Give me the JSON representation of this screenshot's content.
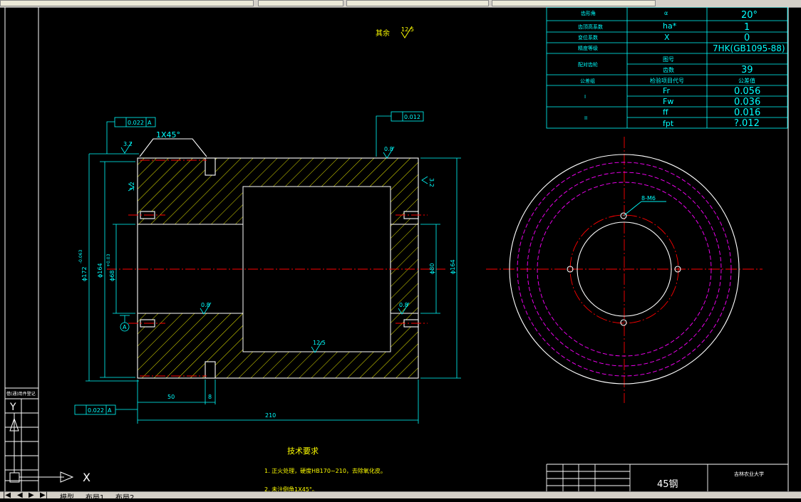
{
  "window": {
    "title": "",
    "top_tabs": [
      "",
      "",
      "",
      ""
    ]
  },
  "ucs": {
    "x_label": "X",
    "y_label": "Y"
  },
  "notes": {
    "surface_rest": "其余",
    "surface_rest_ra": "12.5",
    "tech_req_title": "技术要求",
    "tech_req_1": "1. 正火处理，硬度HB170~210，去除氧化皮。",
    "tech_req_2": "2. 未注倒角1X45°。"
  },
  "section": {
    "chamfer": "1X45°",
    "ra_top_left": "3.2",
    "ra_left_face": "3.2",
    "ra_top_right": "0.8",
    "ra_right_face": "3.2",
    "ra_bore_left": "0.8",
    "ra_bore_right": "0.8",
    "ra_recess": "12.5",
    "gtol_runout_value": "0.022",
    "gtol_runout_datum": "A",
    "gtol_flat_value": "0.012",
    "gtol_bottom_value": "0.022",
    "gtol_bottom_datum": "A",
    "datum_label": "A",
    "dim_outer": "ϕ172",
    "dim_outer_tol": "-0.063",
    "dim_left_bore": "ϕ164",
    "dim_bore_fit": "ϕ68",
    "dim_bore_tol": "+0.03",
    "dim_right_bore": "ϕ80",
    "dim_right_outer": "ϕ164",
    "dim_50": "50",
    "dim_8": "8",
    "dim_210": "210"
  },
  "endview": {
    "hole_label": "8-M6"
  },
  "param_table": {
    "rows": [
      {
        "name": "齿形角",
        "sym": "α",
        "val": "20°"
      },
      {
        "name": "齿顶高系数",
        "sym": "ha*",
        "val": "1"
      },
      {
        "name": "变位系数",
        "sym": "X",
        "val": "0"
      },
      {
        "name": "精度等级",
        "sym": "",
        "val": "7HK(GB1095-88)"
      },
      {
        "name": "配对齿轮",
        "sym": "图号",
        "val": ""
      },
      {
        "name": "",
        "sym": "齿数",
        "val": "39"
      },
      {
        "name": "公差组",
        "sym": "检验项目代号",
        "val": "公差值"
      },
      {
        "name": "I",
        "sym": "Fr",
        "val": "0.056"
      },
      {
        "name": "",
        "sym": "Fw",
        "val": "0.036"
      },
      {
        "name": "II",
        "sym": "ff",
        "val": "0.016"
      },
      {
        "name": "",
        "sym": "fpt",
        "val": "?.012"
      }
    ]
  },
  "title_block": {
    "material": "45钢",
    "school": "吉林农业大学"
  },
  "left_strip": {
    "label": "借(通)用件登记"
  },
  "layout_tabs": {
    "model": "模型",
    "layout1": "布局1",
    "layout2": "布局2"
  },
  "colors": {
    "background": "#000000",
    "outline": "#ffffff",
    "hatch": "#ffff00",
    "centerline": "#ff0000",
    "dimension": "#00ffff",
    "pitch_circle": "#ff00ff"
  }
}
